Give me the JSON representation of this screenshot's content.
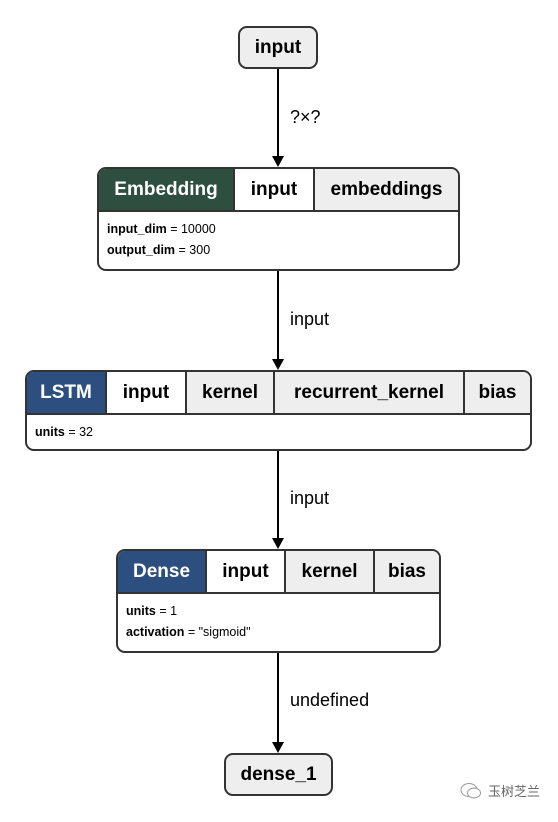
{
  "nodes": {
    "input": {
      "label": "input"
    },
    "embedding": {
      "op": "Embedding",
      "op_color": "#2e4f3f",
      "cells": [
        "input",
        "embeddings"
      ],
      "attrs": [
        {
          "name": "input_dim",
          "value": " = 10000"
        },
        {
          "name": "output_dim",
          "value": " = 300"
        }
      ]
    },
    "lstm": {
      "op": "LSTM",
      "op_color": "#2d4f80",
      "cells": [
        "input",
        "kernel",
        "recurrent_kernel",
        "bias"
      ],
      "attrs": [
        {
          "name": "units",
          "value": " = 32"
        }
      ]
    },
    "dense": {
      "op": "Dense",
      "op_color": "#2d4f80",
      "cells": [
        "input",
        "kernel",
        "bias"
      ],
      "attrs": [
        {
          "name": "units",
          "value": " = 1"
        },
        {
          "name": "activation",
          "value": " = \"sigmoid\""
        }
      ]
    },
    "output": {
      "label": "dense_1"
    }
  },
  "edges": [
    "?×?",
    "input",
    "input",
    "undefined"
  ],
  "watermark": "玉树芝兰"
}
